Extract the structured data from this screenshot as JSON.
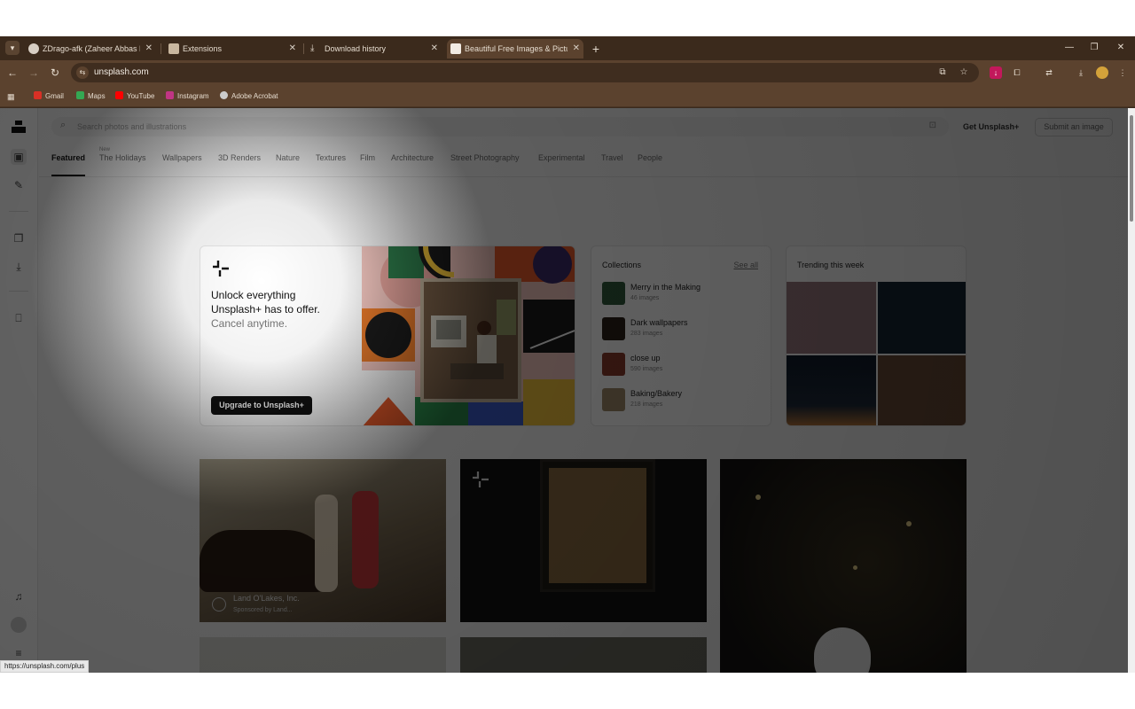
{
  "browser": {
    "tabs": [
      {
        "title": "ZDrago-afk (Zaheer Abbas Khä",
        "icon": "github-icon"
      },
      {
        "title": "Extensions",
        "icon": "puzzle-icon"
      },
      {
        "title": "Download history",
        "icon": "download-icon"
      },
      {
        "title": "Beautiful Free Images & Picture",
        "icon": "unsplash-icon",
        "active": true
      }
    ],
    "new_tab": "+",
    "url": "unsplash.com",
    "bookmarks": [
      {
        "label": "Gmail",
        "color": "#d93025"
      },
      {
        "label": "Maps",
        "color": "#34a853"
      },
      {
        "label": "YouTube",
        "color": "#ff0000"
      },
      {
        "label": "Instagram",
        "color": "#c13584"
      },
      {
        "label": "Adobe Acrobat",
        "color": "#cccccc"
      }
    ],
    "status_url": "https://unsplash.com/plus"
  },
  "header": {
    "search_placeholder": "Search photos and illustrations",
    "get_plus": "Get Unsplash+",
    "submit": "Submit an image"
  },
  "categories": [
    {
      "label": "Featured",
      "active": true
    },
    {
      "label": "The Holidays",
      "tag": "New"
    },
    {
      "label": "Wallpapers"
    },
    {
      "label": "3D Renders"
    },
    {
      "label": "Nature"
    },
    {
      "label": "Textures"
    },
    {
      "label": "Film"
    },
    {
      "label": "Architecture"
    },
    {
      "label": "Street Photography"
    },
    {
      "label": "Experimental"
    },
    {
      "label": "Travel"
    },
    {
      "label": "People"
    }
  ],
  "promo": {
    "line1": "Unlock everything",
    "line2": "Unsplash+ has to offer.",
    "line3": "Cancel anytime.",
    "button": "Upgrade to Unsplash+"
  },
  "collections": {
    "title": "Collections",
    "see_all": "See all",
    "items": [
      {
        "name": "Merry in the Making",
        "count": "46 images",
        "color": "#2f5a3a"
      },
      {
        "name": "Dark wallpapers",
        "count": "283 images",
        "color": "#2b2118"
      },
      {
        "name": "close up",
        "count": "590 images",
        "color": "#8a3a2a"
      },
      {
        "name": "Baking/Bakery",
        "count": "218 images",
        "color": "#a08a6a"
      }
    ]
  },
  "trending": {
    "title": "Trending this week",
    "colors": [
      "#9a7a80",
      "#142635",
      "#0e1a2a",
      "#6a4a36"
    ]
  },
  "photos": [
    {
      "caption": "Land O'Lakes, Inc.",
      "sub": "Sponsored by Land..."
    }
  ]
}
